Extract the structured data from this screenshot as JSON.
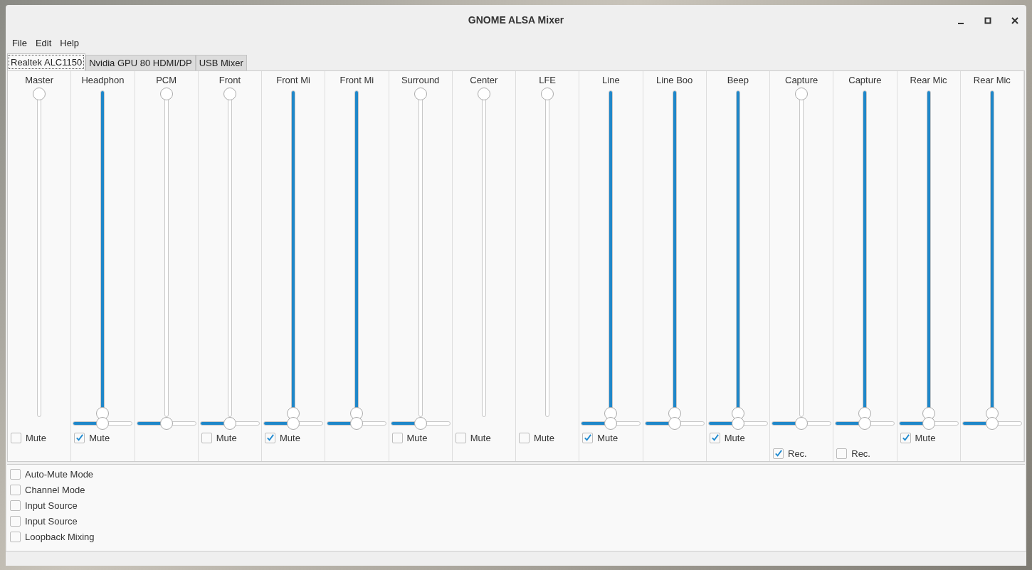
{
  "window": {
    "title": "GNOME ALSA Mixer"
  },
  "menu": [
    "File",
    "Edit",
    "Help"
  ],
  "tabs": [
    {
      "label": "Realtek ALC1150",
      "selected": true
    },
    {
      "label": "Nvidia GPU 80 HDMI/DP",
      "selected": false
    },
    {
      "label": "USB Mixer",
      "selected": false
    }
  ],
  "channels": [
    {
      "name": "Master",
      "level": 0,
      "mute": {
        "label": "Mute",
        "checked": false
      }
    },
    {
      "name": "Headphon",
      "level": 1,
      "balance": {
        "level": 0.5
      },
      "mute": {
        "label": "Mute",
        "checked": true
      }
    },
    {
      "name": "PCM",
      "level": 0,
      "balance": {
        "level": 0.5
      }
    },
    {
      "name": "Front",
      "level": 0,
      "balance": {
        "level": 0.5
      },
      "mute": {
        "label": "Mute",
        "checked": false
      }
    },
    {
      "name": "Front Mi",
      "level": 1,
      "balance": {
        "level": 0.5
      },
      "mute": {
        "label": "Mute",
        "checked": true
      }
    },
    {
      "name": "Front Mi",
      "level": 1,
      "balance": {
        "level": 0.5
      }
    },
    {
      "name": "Surround",
      "level": 0,
      "balance": {
        "level": 0.5
      },
      "mute": {
        "label": "Mute",
        "checked": false
      }
    },
    {
      "name": "Center",
      "level": 0,
      "mute": {
        "label": "Mute",
        "checked": false
      }
    },
    {
      "name": "LFE",
      "level": 0,
      "mute": {
        "label": "Mute",
        "checked": false
      }
    },
    {
      "name": "Line",
      "level": 1,
      "balance": {
        "level": 0.5
      },
      "mute": {
        "label": "Mute",
        "checked": true
      }
    },
    {
      "name": "Line Boo",
      "level": 1,
      "balance": {
        "level": 0.5
      }
    },
    {
      "name": "Beep",
      "level": 1,
      "balance": {
        "level": 0.5
      },
      "mute": {
        "label": "Mute",
        "checked": true
      }
    },
    {
      "name": "Capture",
      "level": 0,
      "balance": {
        "level": 0.5
      },
      "rec": {
        "label": "Rec.",
        "checked": true
      }
    },
    {
      "name": "Capture",
      "level": 1,
      "balance": {
        "level": 0.5
      },
      "rec": {
        "label": "Rec.",
        "checked": false
      }
    },
    {
      "name": "Rear Mic",
      "level": 1,
      "balance": {
        "level": 0.5
      },
      "mute": {
        "label": "Mute",
        "checked": true
      }
    },
    {
      "name": "Rear Mic",
      "level": 1,
      "balance": {
        "level": 0.5
      }
    }
  ],
  "options": [
    {
      "label": "Auto-Mute Mode",
      "checked": false
    },
    {
      "label": "Channel Mode",
      "checked": false
    },
    {
      "label": "Input Source",
      "checked": false
    },
    {
      "label": "Input Source",
      "checked": false
    },
    {
      "label": "Loopback Mixing",
      "checked": false
    }
  ]
}
